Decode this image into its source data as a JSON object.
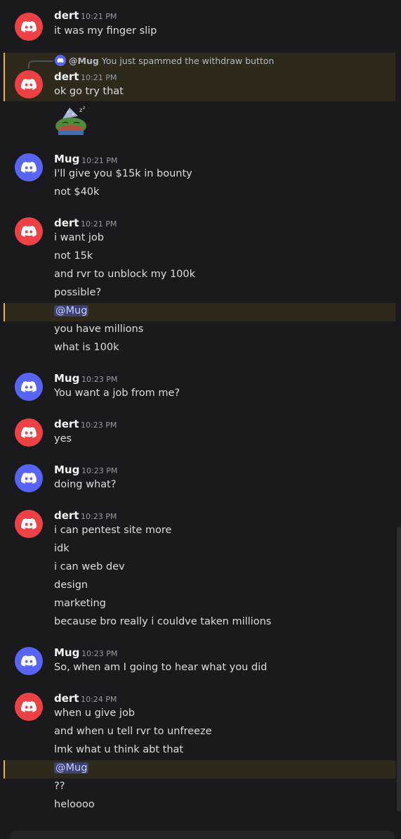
{
  "colors": {
    "dert_avatar": "#ed4245",
    "mug_avatar": "#5865f2",
    "highlight_bg": "#2f291c",
    "highlight_border": "#f0b232",
    "mention_bg": "#3c4270"
  },
  "messages": [
    {
      "user": "dert",
      "time": "10:21 PM",
      "lines": [
        "it was my finger slip"
      ]
    },
    {
      "user": "dert",
      "time": "10:21 PM",
      "reply_to": {
        "user": "@Mug",
        "text": "You just spammed the withdraw button"
      },
      "lines": [
        "ok go try that"
      ],
      "sticker": "sleeping-pepe-sticker"
    },
    {
      "user": "Mug",
      "time": "10:21 PM",
      "lines": [
        "I'll give you $15k in bounty",
        "not $40k"
      ]
    },
    {
      "user": "dert",
      "time": "10:21 PM",
      "lines": [
        "i want job",
        "not 15k",
        "and rvr to unblock my 100k",
        "possible?",
        "@Mug",
        "you have millions",
        "what is 100k"
      ]
    },
    {
      "user": "Mug",
      "time": "10:23 PM",
      "lines": [
        "You want a job from me?"
      ]
    },
    {
      "user": "dert",
      "time": "10:23 PM",
      "lines": [
        "yes"
      ]
    },
    {
      "user": "Mug",
      "time": "10:23 PM",
      "lines": [
        "doing what?"
      ]
    },
    {
      "user": "dert",
      "time": "10:23 PM",
      "lines": [
        "i can pentest site more",
        "idk",
        "i can web dev",
        "design",
        "marketing",
        "because bro really i couldve taken millions"
      ]
    },
    {
      "user": "Mug",
      "time": "10:23 PM",
      "lines": [
        "So, when am I going to hear what you did"
      ]
    },
    {
      "user": "dert",
      "time": "10:24 PM",
      "lines": [
        "when u give job",
        "and when u tell rvr to unfreeze",
        "lmk what u think abt that",
        "@Mug",
        "??",
        "heloooo"
      ]
    }
  ]
}
